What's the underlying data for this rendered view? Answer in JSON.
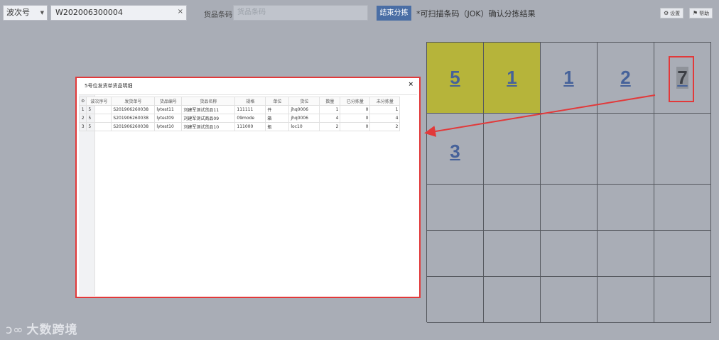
{
  "toolbar": {
    "wave_select_value": "波次号",
    "wave_input_value": "W202006300004",
    "barcode_label": "货品条码:",
    "barcode_placeholder": "货品条码",
    "end_button": "结束分拣",
    "hint": "*可扫描条码（JOK）确认分拣结果",
    "settings_button": "设置",
    "help_button": "帮助"
  },
  "grid": {
    "rows": [
      [
        "5",
        "1",
        "1",
        "2",
        "7"
      ],
      [
        "3",
        "",
        "",
        "",
        ""
      ],
      [
        "",
        "",
        "",
        "",
        ""
      ],
      [
        "",
        "",
        "",
        "",
        ""
      ],
      [
        "",
        "",
        "",
        "",
        ""
      ]
    ],
    "active_cells": [
      [
        0,
        0
      ],
      [
        0,
        1
      ]
    ],
    "marked_cell": [
      0,
      4
    ]
  },
  "modal": {
    "title": "5号位发货单货品明细",
    "columns": [
      "波次序号",
      "发货单号",
      "货品编号",
      "货品名称",
      "规格",
      "单位",
      "货位",
      "数量",
      "已分拣量",
      "未分拣量"
    ],
    "rows": [
      {
        "idx": "1",
        "cells": [
          "5",
          "S201906260038",
          "lytest11",
          "刘建军测试货品11",
          "111111",
          "件",
          "jhq0006",
          "1",
          "0",
          "1"
        ]
      },
      {
        "idx": "2",
        "cells": [
          "5",
          "S201906260038",
          "lytest09",
          "刘建军测试商品09",
          "09mode",
          "箱",
          "jhq0006",
          "4",
          "0",
          "4"
        ]
      },
      {
        "idx": "3",
        "cells": [
          "5",
          "S201906260038",
          "lytest10",
          "刘建军测试货品10",
          "111000",
          "瓶",
          "loc10",
          "2",
          "0",
          "2"
        ]
      }
    ]
  },
  "watermark": "大数跨境",
  "colors": {
    "accent": "#4a6ea5",
    "active_cell": "#b6b43a",
    "annotation_red": "#e2393a"
  }
}
